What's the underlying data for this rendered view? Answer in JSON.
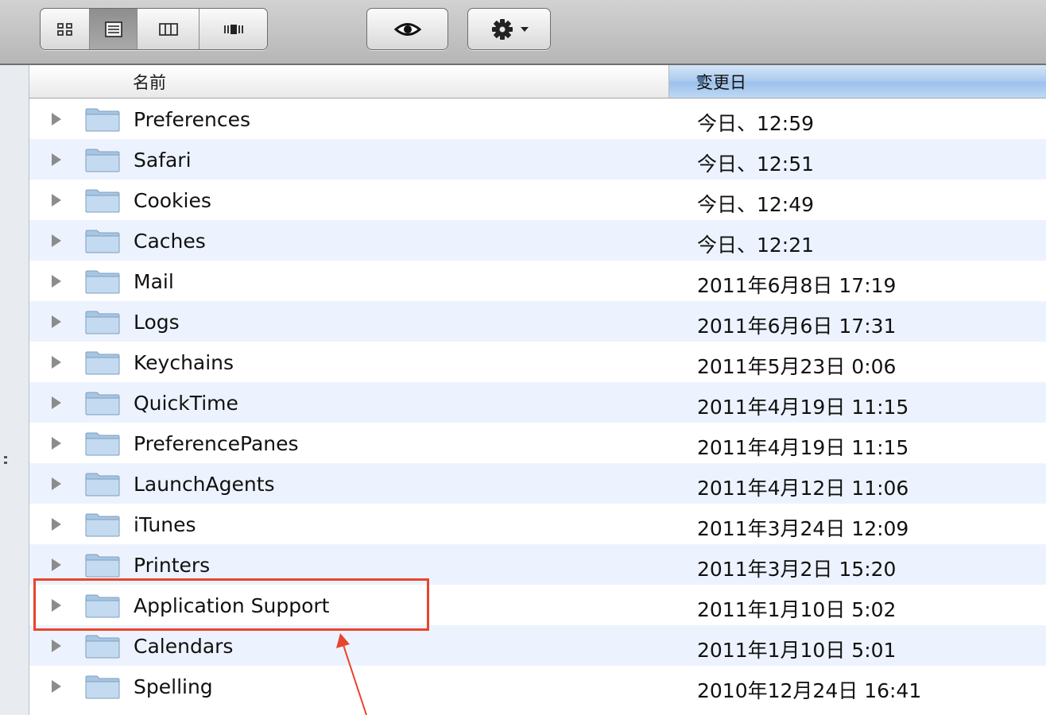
{
  "toolbar": {
    "view_buttons": [
      {
        "icon": "icon-view-icon",
        "active": false
      },
      {
        "icon": "list-view-icon",
        "active": true
      },
      {
        "icon": "column-view-icon",
        "active": false
      },
      {
        "icon": "coverflow-view-icon",
        "active": false
      }
    ],
    "quicklook_icon": "eye-icon",
    "action_icon": "gear-icon",
    "action_menu_icon": "chevron-down-icon"
  },
  "columns": {
    "name": "名前",
    "date_modified": "変更日",
    "sort_indicator": "▼"
  },
  "files": [
    {
      "name": "Preferences",
      "date": "今日、12:59"
    },
    {
      "name": "Safari",
      "date": "今日、12:51"
    },
    {
      "name": "Cookies",
      "date": "今日、12:49"
    },
    {
      "name": "Caches",
      "date": "今日、12:21"
    },
    {
      "name": "Mail",
      "date": "2011年6月8日 17:19"
    },
    {
      "name": "Logs",
      "date": "2011年6月6日 17:31"
    },
    {
      "name": "Keychains",
      "date": "2011年5月23日 0:06"
    },
    {
      "name": "QuickTime",
      "date": "2011年4月19日 11:15"
    },
    {
      "name": "PreferencePanes",
      "date": "2011年4月19日 11:15"
    },
    {
      "name": "LaunchAgents",
      "date": "2011年4月12日 11:06"
    },
    {
      "name": "iTunes",
      "date": "2011年3月24日 12:09"
    },
    {
      "name": "Printers",
      "date": "2011年3月2日 15:20"
    },
    {
      "name": "Application Support",
      "date": "2011年1月10日 5:02"
    },
    {
      "name": "Calendars",
      "date": "2011年1月10日 5:01"
    },
    {
      "name": "Spelling",
      "date": "2010年12月24日 16:41"
    }
  ],
  "annotation": {
    "color": "#e8452c",
    "target": "Application Support"
  }
}
